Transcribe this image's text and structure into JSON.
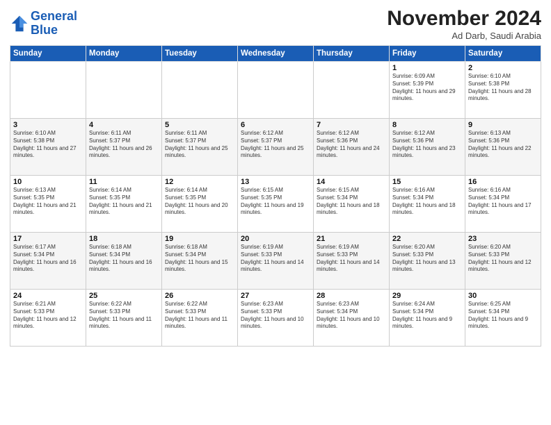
{
  "header": {
    "logo_line1": "General",
    "logo_line2": "Blue",
    "month": "November 2024",
    "location": "Ad Darb, Saudi Arabia"
  },
  "weekdays": [
    "Sunday",
    "Monday",
    "Tuesday",
    "Wednesday",
    "Thursday",
    "Friday",
    "Saturday"
  ],
  "weeks": [
    [
      {
        "day": "",
        "info": ""
      },
      {
        "day": "",
        "info": ""
      },
      {
        "day": "",
        "info": ""
      },
      {
        "day": "",
        "info": ""
      },
      {
        "day": "",
        "info": ""
      },
      {
        "day": "1",
        "info": "Sunrise: 6:09 AM\nSunset: 5:39 PM\nDaylight: 11 hours and 29 minutes."
      },
      {
        "day": "2",
        "info": "Sunrise: 6:10 AM\nSunset: 5:38 PM\nDaylight: 11 hours and 28 minutes."
      }
    ],
    [
      {
        "day": "3",
        "info": "Sunrise: 6:10 AM\nSunset: 5:38 PM\nDaylight: 11 hours and 27 minutes."
      },
      {
        "day": "4",
        "info": "Sunrise: 6:11 AM\nSunset: 5:37 PM\nDaylight: 11 hours and 26 minutes."
      },
      {
        "day": "5",
        "info": "Sunrise: 6:11 AM\nSunset: 5:37 PM\nDaylight: 11 hours and 25 minutes."
      },
      {
        "day": "6",
        "info": "Sunrise: 6:12 AM\nSunset: 5:37 PM\nDaylight: 11 hours and 25 minutes."
      },
      {
        "day": "7",
        "info": "Sunrise: 6:12 AM\nSunset: 5:36 PM\nDaylight: 11 hours and 24 minutes."
      },
      {
        "day": "8",
        "info": "Sunrise: 6:12 AM\nSunset: 5:36 PM\nDaylight: 11 hours and 23 minutes."
      },
      {
        "day": "9",
        "info": "Sunrise: 6:13 AM\nSunset: 5:36 PM\nDaylight: 11 hours and 22 minutes."
      }
    ],
    [
      {
        "day": "10",
        "info": "Sunrise: 6:13 AM\nSunset: 5:35 PM\nDaylight: 11 hours and 21 minutes."
      },
      {
        "day": "11",
        "info": "Sunrise: 6:14 AM\nSunset: 5:35 PM\nDaylight: 11 hours and 21 minutes."
      },
      {
        "day": "12",
        "info": "Sunrise: 6:14 AM\nSunset: 5:35 PM\nDaylight: 11 hours and 20 minutes."
      },
      {
        "day": "13",
        "info": "Sunrise: 6:15 AM\nSunset: 5:35 PM\nDaylight: 11 hours and 19 minutes."
      },
      {
        "day": "14",
        "info": "Sunrise: 6:15 AM\nSunset: 5:34 PM\nDaylight: 11 hours and 18 minutes."
      },
      {
        "day": "15",
        "info": "Sunrise: 6:16 AM\nSunset: 5:34 PM\nDaylight: 11 hours and 18 minutes."
      },
      {
        "day": "16",
        "info": "Sunrise: 6:16 AM\nSunset: 5:34 PM\nDaylight: 11 hours and 17 minutes."
      }
    ],
    [
      {
        "day": "17",
        "info": "Sunrise: 6:17 AM\nSunset: 5:34 PM\nDaylight: 11 hours and 16 minutes."
      },
      {
        "day": "18",
        "info": "Sunrise: 6:18 AM\nSunset: 5:34 PM\nDaylight: 11 hours and 16 minutes."
      },
      {
        "day": "19",
        "info": "Sunrise: 6:18 AM\nSunset: 5:34 PM\nDaylight: 11 hours and 15 minutes."
      },
      {
        "day": "20",
        "info": "Sunrise: 6:19 AM\nSunset: 5:33 PM\nDaylight: 11 hours and 14 minutes."
      },
      {
        "day": "21",
        "info": "Sunrise: 6:19 AM\nSunset: 5:33 PM\nDaylight: 11 hours and 14 minutes."
      },
      {
        "day": "22",
        "info": "Sunrise: 6:20 AM\nSunset: 5:33 PM\nDaylight: 11 hours and 13 minutes."
      },
      {
        "day": "23",
        "info": "Sunrise: 6:20 AM\nSunset: 5:33 PM\nDaylight: 11 hours and 12 minutes."
      }
    ],
    [
      {
        "day": "24",
        "info": "Sunrise: 6:21 AM\nSunset: 5:33 PM\nDaylight: 11 hours and 12 minutes."
      },
      {
        "day": "25",
        "info": "Sunrise: 6:22 AM\nSunset: 5:33 PM\nDaylight: 11 hours and 11 minutes."
      },
      {
        "day": "26",
        "info": "Sunrise: 6:22 AM\nSunset: 5:33 PM\nDaylight: 11 hours and 11 minutes."
      },
      {
        "day": "27",
        "info": "Sunrise: 6:23 AM\nSunset: 5:33 PM\nDaylight: 11 hours and 10 minutes."
      },
      {
        "day": "28",
        "info": "Sunrise: 6:23 AM\nSunset: 5:34 PM\nDaylight: 11 hours and 10 minutes."
      },
      {
        "day": "29",
        "info": "Sunrise: 6:24 AM\nSunset: 5:34 PM\nDaylight: 11 hours and 9 minutes."
      },
      {
        "day": "30",
        "info": "Sunrise: 6:25 AM\nSunset: 5:34 PM\nDaylight: 11 hours and 9 minutes."
      }
    ]
  ]
}
